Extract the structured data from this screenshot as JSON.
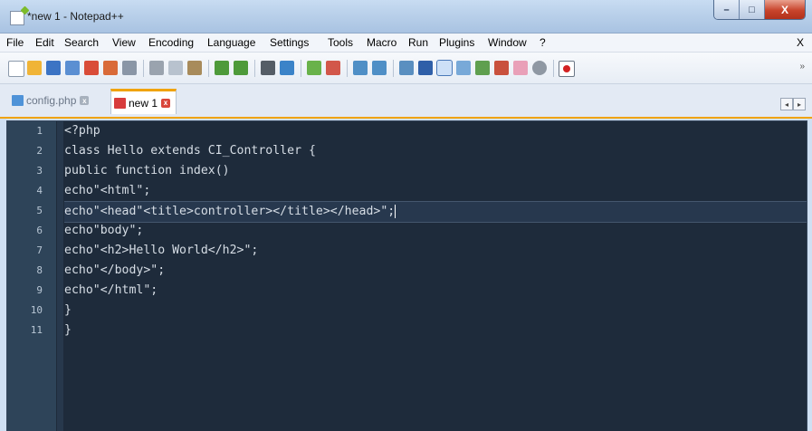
{
  "window": {
    "title": "*new 1 - Notepad++",
    "minimize_glyph": "–",
    "maximize_glyph": "□",
    "close_glyph": "X"
  },
  "menu": {
    "items": [
      "File",
      "Edit",
      "Search",
      "View",
      "Encoding",
      "Language",
      "Settings",
      "Tools",
      "Macro",
      "Run",
      "Plugins",
      "Window",
      "?"
    ],
    "close_glyph": "X"
  },
  "toolbar": {
    "icons": [
      "new-file-icon",
      "open-file-icon",
      "save-icon",
      "save-all-icon",
      "close-icon",
      "close-all-icon",
      "print-icon",
      "cut-icon",
      "copy-icon",
      "paste-icon",
      "undo-icon",
      "redo-icon",
      "find-icon",
      "replace-icon",
      "zoom-in-icon",
      "zoom-out-icon",
      "sync-vertical-icon",
      "sync-horizontal-icon",
      "word-wrap-icon",
      "show-all-chars-icon",
      "indent-guide-icon",
      "user-lang-icon",
      "doc-map-icon",
      "function-list-icon",
      "folder-workspace-icon",
      "monitoring-icon",
      "record-macro-icon"
    ],
    "overflow": "»"
  },
  "tabs": [
    {
      "label": "config.php",
      "state": "inactive"
    },
    {
      "label": "new 1",
      "state": "active",
      "modified": true
    }
  ],
  "editor": {
    "current_line": 5,
    "lines": [
      {
        "num": "1",
        "text": "<?php"
      },
      {
        "num": "2",
        "text": "class Hello extends CI_Controller {"
      },
      {
        "num": "3",
        "text": "public function index()"
      },
      {
        "num": "4",
        "text": "echo\"<html\";"
      },
      {
        "num": "5",
        "text": "echo\"<head\"<title>controller></title></head>\";"
      },
      {
        "num": "6",
        "text": "echo\"body\";"
      },
      {
        "num": "7",
        "text": "echo\"<h2>Hello World</h2>\";"
      },
      {
        "num": "8",
        "text": "echo\"</body>\";"
      },
      {
        "num": "9",
        "text": "echo\"</html\";"
      },
      {
        "num": "10",
        "text": "}"
      },
      {
        "num": "11",
        "text": "}"
      }
    ]
  },
  "colors": {
    "editor_bg": "#1e2b3b",
    "gutter_bg": "#2e4459",
    "tab_accent": "#f0a30a"
  }
}
